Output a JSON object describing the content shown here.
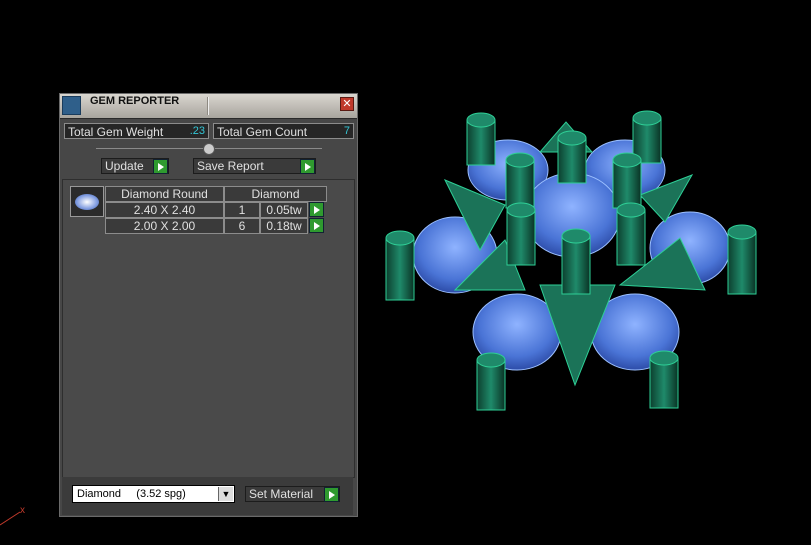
{
  "window": {
    "title": "GEM REPORTER",
    "close_glyph": "✕"
  },
  "summary": {
    "total_weight_label": "Total Gem Weight",
    "total_weight_value": ".23",
    "total_count_label": "Total Gem Count",
    "total_count_value": "7"
  },
  "actions": {
    "update_label": "Update",
    "save_report_label": "Save Report"
  },
  "table": {
    "headers": [
      "Diamond Round",
      "Diamond"
    ],
    "rows": [
      {
        "size": "2.40 X 2.40",
        "count": "1",
        "weight": "0.05tw"
      },
      {
        "size": "2.00 X 2.00",
        "count": "6",
        "weight": "0.18tw"
      }
    ]
  },
  "material": {
    "selected": "Diamond     (3.52 spg)",
    "set_label": "Set Material"
  },
  "axis": {
    "x_label": "x"
  },
  "colors": {
    "metal": "#1f8a6a",
    "gem": "#4d7fe0",
    "go_button": "#2f9a2f"
  }
}
